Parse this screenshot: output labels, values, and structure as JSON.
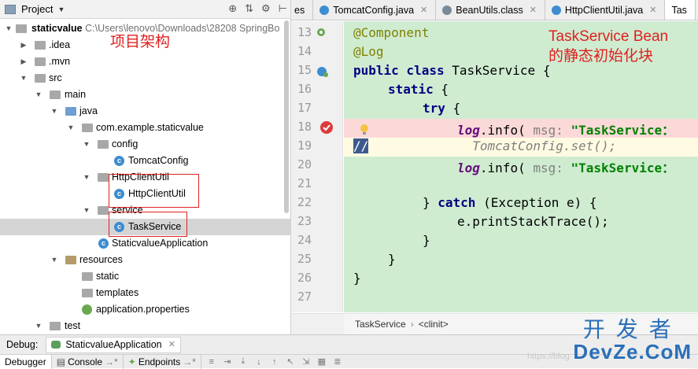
{
  "project_panel": {
    "title": "Project",
    "tools": [
      "⊕",
      "⇅",
      "⚙",
      "⊢"
    ],
    "tree": [
      {
        "label": "staticvalue",
        "path": "C:\\Users\\lenovo\\Downloads\\28208 SpringBo",
        "icon": "folder-icon",
        "expanded": true,
        "selected": false
      },
      {
        "label": ".idea",
        "icon": "folder-icon",
        "expanded": false,
        "selected": false
      },
      {
        "label": ".mvn",
        "icon": "folder-icon",
        "expanded": false,
        "selected": false
      },
      {
        "label": "src",
        "icon": "folder-icon",
        "expanded": true,
        "selected": false
      },
      {
        "label": "main",
        "icon": "folder-icon",
        "expanded": true,
        "selected": false
      },
      {
        "label": "java",
        "icon": "source-folder-icon",
        "expanded": true,
        "selected": false
      },
      {
        "label": "com.example.staticvalue",
        "icon": "package-icon",
        "expanded": true,
        "selected": false
      },
      {
        "label": "config",
        "icon": "package-icon",
        "expanded": true,
        "selected": false
      },
      {
        "label": "TomcatConfig",
        "icon": "class-icon",
        "selected": false
      },
      {
        "label": "HttpClientUtil",
        "icon": "package-icon",
        "expanded": true,
        "selected": false
      },
      {
        "label": "HttpClientUtil",
        "icon": "class-icon",
        "selected": false
      },
      {
        "label": "service",
        "icon": "package-icon",
        "expanded": true,
        "selected": false
      },
      {
        "label": "TaskService",
        "icon": "class-icon",
        "selected": true
      },
      {
        "label": "StaticvalueApplication",
        "icon": "spring-class-icon",
        "selected": false
      },
      {
        "label": "resources",
        "icon": "resources-folder-icon",
        "expanded": true,
        "selected": false
      },
      {
        "label": "static",
        "icon": "folder-icon",
        "selected": false
      },
      {
        "label": "templates",
        "icon": "folder-icon",
        "selected": false
      },
      {
        "label": "application.properties",
        "icon": "properties-icon",
        "selected": false
      },
      {
        "label": "test",
        "icon": "folder-icon",
        "expanded": true,
        "selected": false
      }
    ],
    "annotation": "项目架构"
  },
  "editor": {
    "tabs": [
      {
        "label": "es",
        "icon": "none"
      },
      {
        "label": "TomcatConfig.java",
        "icon": "class-icon"
      },
      {
        "label": "BeanUtils.class",
        "icon": "class-icon"
      },
      {
        "label": "HttpClientUtil.java",
        "icon": "class-icon"
      },
      {
        "label": "Tas",
        "icon": "class-icon"
      }
    ],
    "line_numbers": [
      "13",
      "14",
      "15",
      "16",
      "17",
      "18",
      "19",
      "20",
      "21",
      "22",
      "23",
      "24",
      "25",
      "26",
      "27"
    ],
    "code": {
      "l13": "@Component",
      "l14": "@Log",
      "l15_kw": "public class",
      "l15_name": " TaskService ",
      "l15_brace": "{",
      "l16_kw": "static",
      "l16_brace": " {",
      "l17_kw": "try",
      "l17_brace": " {",
      "l18_fld": "log",
      "l18_call": ".info(",
      "l18_hint": " msg:",
      "l18_str": " \"TaskService：",
      "l19_cmt": "//",
      "l19_code": "TomcatConfig.set();",
      "l20_fld": "log",
      "l20_call": ".info(",
      "l20_hint": " msg:",
      "l20_str": " \"TaskService：",
      "l22_brace": "} ",
      "l22_kw": "catch",
      "l22_rest": " (Exception e) {",
      "l23": "e.printStackTrace();",
      "l24": "}",
      "l25": "}",
      "l26": "}"
    },
    "annotation_line1": "TaskService Bean",
    "annotation_line2": "的静态初始化块",
    "breadcrumb": [
      "TaskService",
      "<clinit>"
    ]
  },
  "debug": {
    "label": "Debug:",
    "session": "StaticvalueApplication",
    "toolbar": [
      "Debugger",
      "Console",
      "Endpoints"
    ],
    "toolbar_glyphs": [
      "≡",
      "⇥",
      "⤓",
      "↓",
      "↑",
      "↖",
      "⇲",
      "▦",
      "≣"
    ]
  },
  "watermark": {
    "cn": "开发者",
    "en": "DevZe.CoM",
    "url": "https://blog"
  },
  "colors": {
    "annotation": "#e02020",
    "selection": "#d5d5d5",
    "editor_bg": "#cfecd1",
    "breakpoint_line": "#fbd9d9",
    "class_icon": "#3d8dd0"
  }
}
